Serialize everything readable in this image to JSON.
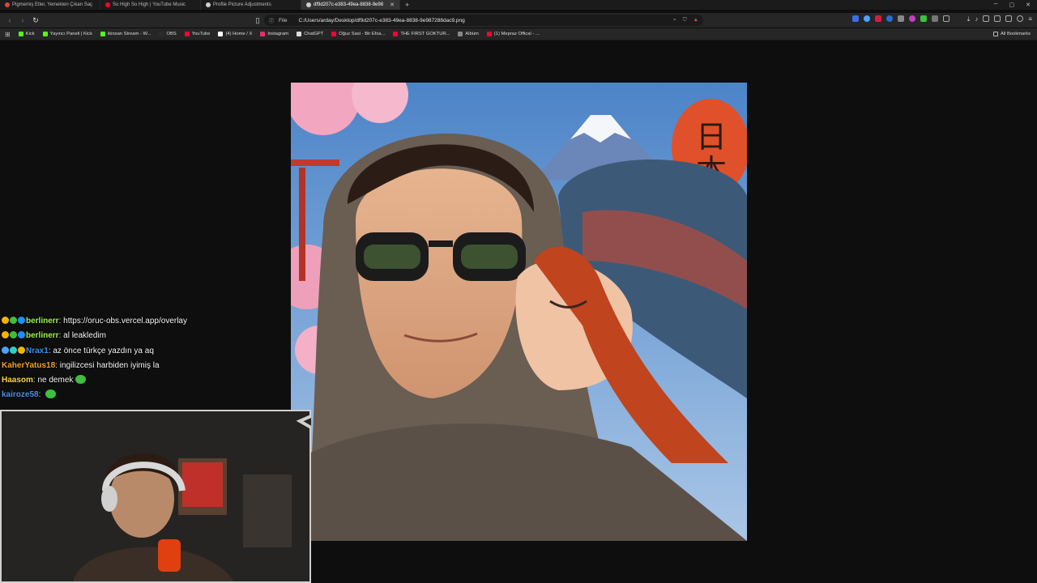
{
  "tabs": [
    {
      "label": "Pigmemiş Etler, Yemekten Çıkan Saç",
      "color": "#e0473c"
    },
    {
      "label": "So High So High | YouTube Music",
      "color": "#ff0033"
    },
    {
      "label": "Profile Picture Adjustments",
      "color": "#cfcfcf"
    },
    {
      "label": "df9d207c-e383-49ea-8838-9e98",
      "color": "#cfcfcf",
      "active": true
    }
  ],
  "window_controls": {
    "minimize": "─",
    "maximize": "▢",
    "close": "✕"
  },
  "toolbar": {
    "back": "‹",
    "forward": "›",
    "reload": "↻",
    "scheme_chip": "File",
    "url": "C:/Users/arday/Desktop/df9d207c-e383-49ea-8838-9e987288dac9.png"
  },
  "bookmarks": [
    {
      "label": "Kick",
      "color": "#53fc18"
    },
    {
      "label": "Yayıncı Paneli | Kick",
      "color": "#53fc18"
    },
    {
      "label": "ikinsan Stream - W...",
      "color": "#53fc18"
    },
    {
      "label": "OBS",
      "color": "#2b2b2b"
    },
    {
      "label": "YouTube",
      "color": "#ff0033"
    },
    {
      "label": "(4) Home / X",
      "color": "#ffffff"
    },
    {
      "label": "Instagram",
      "color": "#e1306c"
    },
    {
      "label": "ChatGPT",
      "color": "#dddddd"
    },
    {
      "label": "Oğuz Sasi - Bir Efsa...",
      "color": "#ff0033"
    },
    {
      "label": "THE FIRST GOKTUR...",
      "color": "#ff0033"
    },
    {
      "label": "Albüm",
      "color": "#888888"
    },
    {
      "label": "(1) Mepraz Offical - ...",
      "color": "#ff0033"
    }
  ],
  "all_bookmarks": "All Bookmarks",
  "chat": [
    {
      "badges": [
        "#f5b400",
        "#3fbf3f",
        "#1e90ff"
      ],
      "name": "berlinerr",
      "name_color": "#9cf24d",
      "text": "https://oruc-obs.vercel.app/overlay"
    },
    {
      "badges": [
        "#f5b400",
        "#3fbf3f",
        "#1e90ff"
      ],
      "name": "berlinerr",
      "name_color": "#9cf24d",
      "text": "al leakledim"
    },
    {
      "badges": [
        "#4aa3ff",
        "#2fd0c0",
        "#f5b400"
      ],
      "name": "Nrax1",
      "name_color": "#3d8fe0",
      "text": "az önce türkçe yazdın ya aq"
    },
    {
      "badges": [],
      "name": "KaherYatus18",
      "name_color": "#f0a020",
      "text": "ingilizcesi harbiden iyimiş la"
    },
    {
      "badges": [],
      "name": "Haasom",
      "name_color": "#f7d24a",
      "text": "ne demek",
      "emote": true
    },
    {
      "badges": [],
      "name": "kairoze58",
      "name_color": "#4a8fe8",
      "text": "",
      "emote": true
    }
  ],
  "colors": {
    "tab_bar": "#1b1b1b",
    "toolbar": "#262626",
    "page_bg": "#0e0e0e"
  }
}
